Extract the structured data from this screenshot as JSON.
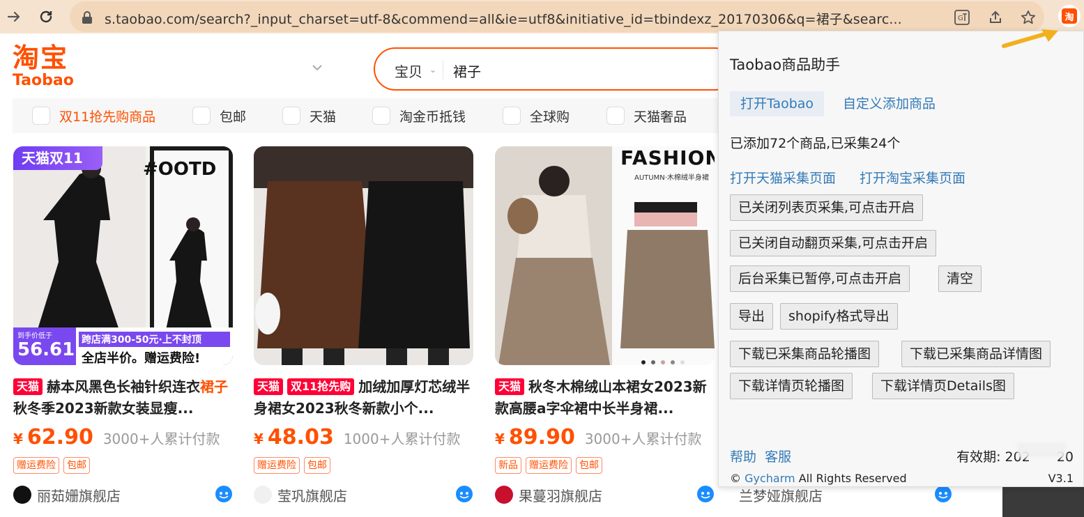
{
  "browser": {
    "url": "s.taobao.com/search?_input_charset=utf-8&commend=all&ie=utf8&initiative_id=tbindexz_20170306&q=裙子&searc...",
    "extension_badge": "淘"
  },
  "header": {
    "logo_cn": "淘宝",
    "logo_en": "Taobao",
    "search_category": "宝贝",
    "search_query": "裙子"
  },
  "filters": [
    "双11抢先购商品",
    "包邮",
    "天猫",
    "淘金币抵钱",
    "全球购",
    "天猫奢品"
  ],
  "products": [
    {
      "tags": [
        "天猫"
      ],
      "title_a": "赫本风黑色长袖针织连衣",
      "title_hl": "裙子",
      "title_b": "秋冬季2023新款女装显瘦...",
      "price": "62.90",
      "sales": "3000+人累计付款",
      "badges": [
        "赠运费险",
        "包邮"
      ],
      "shop": "丽茹姗旗舰店",
      "img_texts": {
        "corner": "天猫双11",
        "ootd": "#OOTD",
        "promo_small": "到手价低于",
        "promo_price": "56.61",
        "promo_line1": "跨店满300-50元·上不封顶",
        "promo_line2": "全店半价。赠运费险!"
      }
    },
    {
      "tags": [
        "天猫",
        "双11抢先购"
      ],
      "title_a": "加绒加厚灯芯绒半身裙女2023秋冬新款小个...",
      "price": "48.03",
      "sales": "1000+人累计付款",
      "badges": [
        "赠运费险",
        "包邮"
      ],
      "shop": "莹巩旗舰店"
    },
    {
      "tags": [
        "天猫"
      ],
      "title_a": "秋冬木棉绒山本裙女2023新款高腰a字伞裙中长半身裙...",
      "price": "89.90",
      "sales": "3000+人累计付款",
      "badges": [
        "新品",
        "赠运费险",
        "包邮"
      ],
      "shop": "果蔓羽旗舰店",
      "img_texts": {
        "fashion": "FASHION",
        "sub": "AUTUMN·木棉绒半身裙"
      }
    }
  ],
  "partial_shop": "兰梦娅旗舰店",
  "popup": {
    "title": "Taobao商品助手",
    "tab_open": "打开Taobao",
    "tab_custom": "自定义添加商品",
    "status": "已添加72个商品,已采集24个",
    "link_tmall": "打开天猫采集页面",
    "link_taobao": "打开淘宝采集页面",
    "btn_list": "已关闭列表页采集,可点击开启",
    "btn_autopage": "已关闭自动翻页采集,可点击开启",
    "btn_bg": "后台采集已暂停,可点击开启",
    "btn_clear": "清空",
    "btn_export": "导出",
    "btn_shopify": "shopify格式导出",
    "btn_dl_carousel": "下载已采集商品轮播图",
    "btn_dl_detail": "下载已采集商品详情图",
    "btn_dl_page_carousel": "下载详情页轮播图",
    "btn_dl_page_details": "下载详情页Details图",
    "help": "帮助",
    "service": "客服",
    "expiry_label": "有效期: 202",
    "expiry_tail": "20",
    "copy_prefix": "©",
    "copy_link": "Gycharm",
    "copy_suffix": "All Rights Reserved",
    "version": "V3.1"
  },
  "colors": {
    "brand": "#ff5000",
    "tmall": "#ff0036",
    "link": "#337ab7"
  }
}
